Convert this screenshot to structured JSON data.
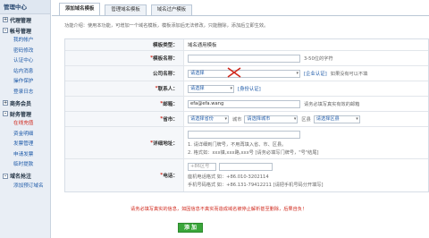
{
  "sidebar": {
    "title": "管理中心",
    "sections": [
      {
        "label": "代理管理",
        "expander": "+",
        "items": []
      },
      {
        "label": "帐号管理",
        "expander": "-",
        "items": [
          "我的帐户",
          "密码修改",
          "认证中心",
          "站内消息",
          "操作保护",
          "登录日志"
        ]
      },
      {
        "label": "商务会员",
        "expander": "+",
        "items": []
      },
      {
        "label": "财务管理",
        "expander": "-",
        "items": [
          "在线充值",
          "资金明细",
          "发票管理",
          "申请发票",
          "临时提款"
        ]
      },
      {
        "label": "域名抢注",
        "expander": "-",
        "items": [
          "添加预订域名"
        ]
      }
    ],
    "active_item": "在线充值"
  },
  "tabs": [
    "添加域名模板",
    "管理域名模板",
    "域名过户模板"
  ],
  "active_tab": 0,
  "intro": "功能介绍：使用本功能，可增加一个域名模板，模板添加后无法修改，只能删除，添加后立即生效。",
  "form": {
    "template_type": {
      "label": "模板类型：",
      "value": "域名通用模板"
    },
    "template_name": {
      "label": "模板名称：",
      "value": "",
      "hint": "3-50位的字符"
    },
    "company": {
      "label": "公司名称：",
      "select": "请选择",
      "link": "[企业认证]",
      "hint": "如果没有可以不填"
    },
    "contact": {
      "label": "联系人：",
      "select": "请选择",
      "link": "[身份认证]"
    },
    "email": {
      "label": "邮箱：",
      "value": "efa@efa.wang",
      "hint": "请务必填写真实有效的邮箱"
    },
    "region": {
      "label": "省市：",
      "province": "请选择省份",
      "city_label": "城市",
      "city": "请选择城市",
      "district_label": "区县",
      "district": "请选择区县"
    },
    "address": {
      "label": "详细地址：",
      "hint1": "1. 请详细到门牌号，不用再填入省、市、区县。",
      "hint2": "2. 格式如：xxx镇,xxx路,xxx号 [请务必填写门牌号，\"号\"结尾]"
    },
    "phone": {
      "label": "电话：",
      "code": "+86",
      "code_suffix": "区号",
      "hint1": "座机电话格式 如：+86.010-3202114",
      "hint2": "手机号码格式 如：+86.131-79412211 [请把手机号码分开填写]"
    }
  },
  "warning": "请务必填写真实的信息，如因信息不真实而造成域名被停止解析甚至删除，后果自负！",
  "submit_label": "添 加",
  "colors": {
    "link": "#1e5aa8",
    "warning": "#d0281c",
    "submit": "#3aa63a"
  }
}
